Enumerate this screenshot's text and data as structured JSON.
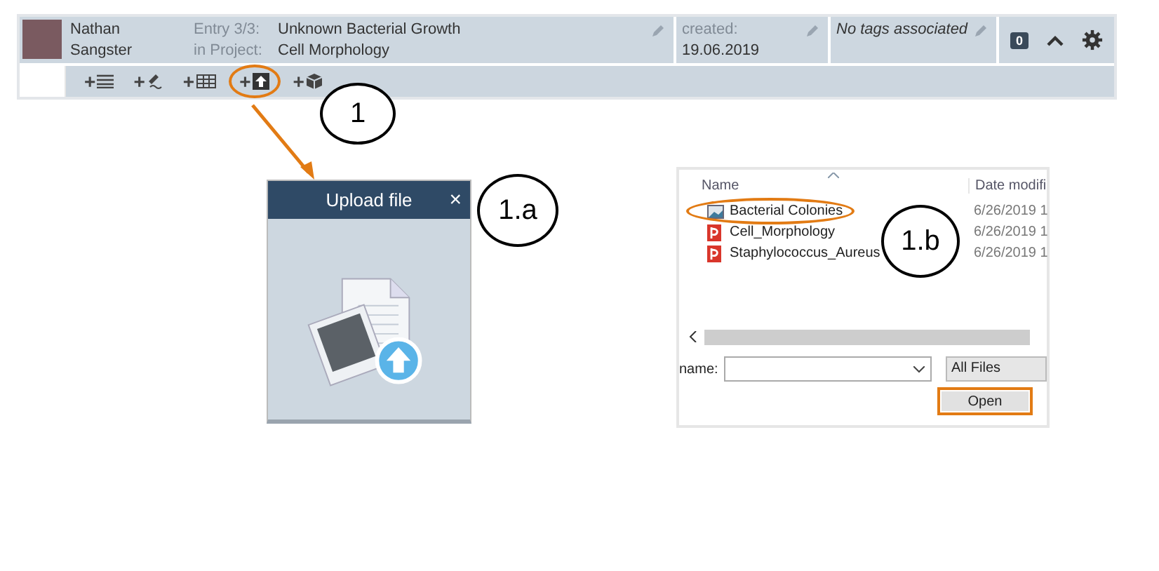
{
  "entry_header": {
    "user_name": "Nathan Sangster",
    "entry_label": "Entry 3/3:",
    "project_label": "in Project:",
    "entry_title": "Unknown Bacterial Growth",
    "project_name": "Cell Morphology",
    "created_label": "created:",
    "created_date": "19.06.2019",
    "tags": "No tags associated",
    "comment_count": "0"
  },
  "toolbar": [
    {
      "kind": "text",
      "label": "+",
      "highlighted": false
    },
    {
      "kind": "sketch",
      "label": "+",
      "highlighted": false
    },
    {
      "kind": "table",
      "label": "+",
      "highlighted": false
    },
    {
      "kind": "upload",
      "label": "+",
      "highlighted": true
    },
    {
      "kind": "box",
      "label": "+",
      "highlighted": false
    }
  ],
  "callouts": [
    {
      "label": "1"
    },
    {
      "label": "1.a"
    },
    {
      "label": "1.b"
    }
  ],
  "upload_panel": {
    "title": "Upload file",
    "close": "×"
  },
  "file_dialog": {
    "columns": [
      "Name",
      "Date modifi"
    ],
    "files": [
      {
        "kind": "image",
        "name": "Bacterial Colonies",
        "date": "6/26/2019 1",
        "highlighted": true
      },
      {
        "kind": "pdf",
        "name": "Cell_Morphology",
        "date": "6/26/2019 1",
        "highlighted": false
      },
      {
        "kind": "pdf",
        "name": "Staphylococcus_Aureus",
        "date": "6/26/2019 1",
        "highlighted": false
      }
    ],
    "file_name_label": "name:",
    "filter": "All Files",
    "open_button": {
      "label": "Open",
      "highlighted": true
    }
  }
}
